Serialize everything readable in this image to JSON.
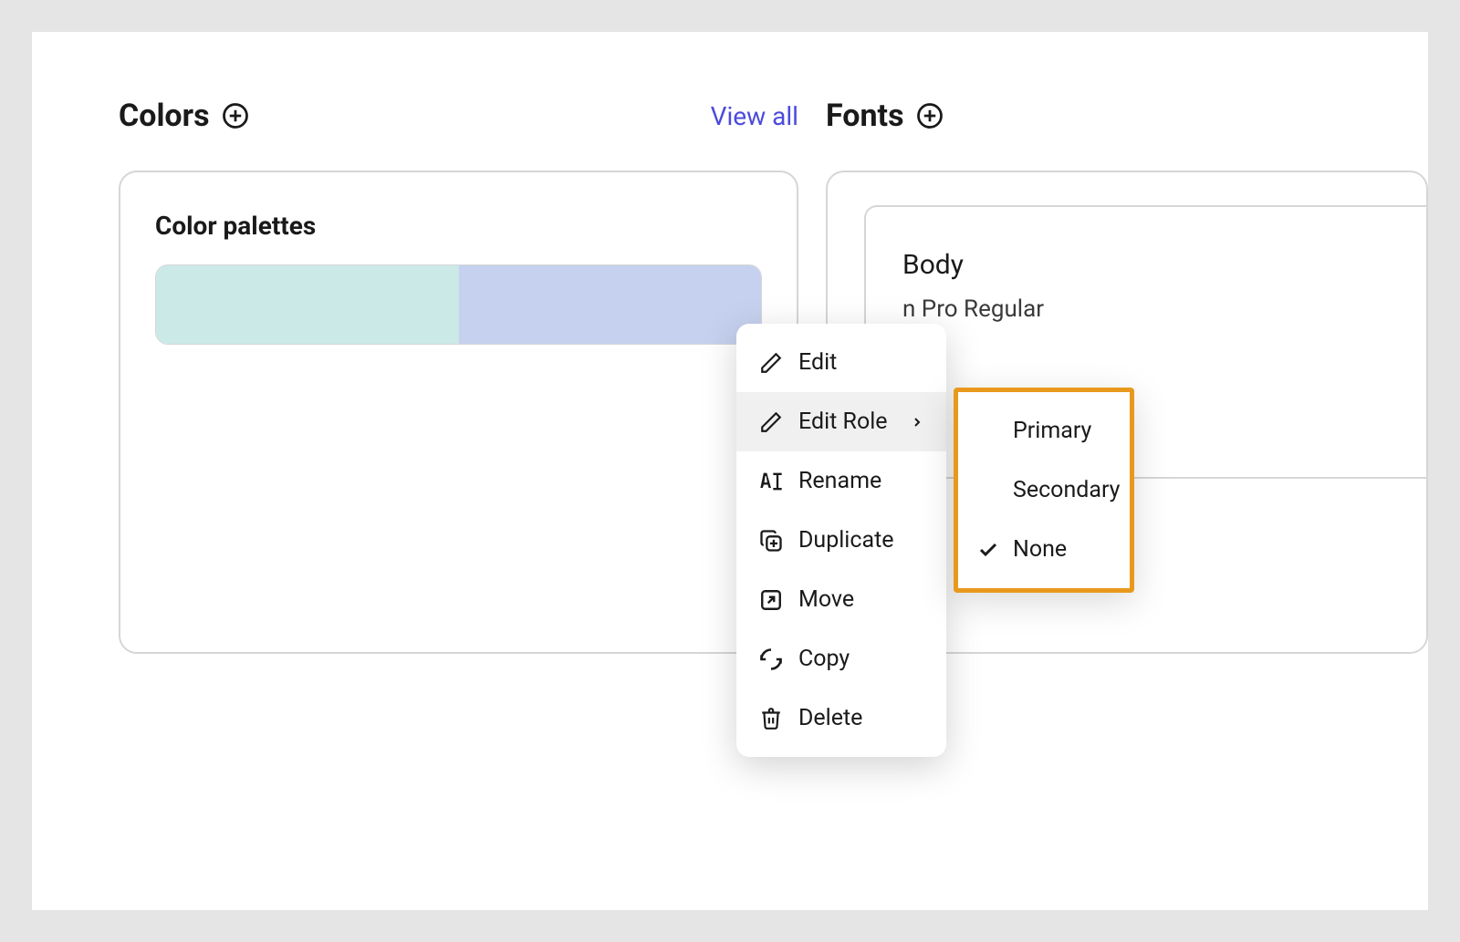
{
  "sections": {
    "colors": {
      "title": "Colors",
      "view_all": "View all",
      "card": {
        "subheading": "Color palettes",
        "palette": [
          {
            "hex": "#cbe9e7"
          },
          {
            "hex": "#c5d1ee"
          }
        ]
      }
    },
    "fonts": {
      "title": "Fonts",
      "card": {
        "label": "Body",
        "font_name_visible": "n Pro Regular"
      }
    }
  },
  "context_menu": {
    "items": [
      {
        "icon": "pencil-icon",
        "label": "Edit"
      },
      {
        "icon": "pencil-icon",
        "label": "Edit Role",
        "has_submenu": true,
        "hovered": true
      },
      {
        "icon": "rename-icon",
        "label": "Rename"
      },
      {
        "icon": "duplicate-icon",
        "label": "Duplicate"
      },
      {
        "icon": "move-icon",
        "label": "Move"
      },
      {
        "icon": "copy-icon",
        "label": "Copy"
      },
      {
        "icon": "delete-icon",
        "label": "Delete"
      }
    ]
  },
  "submenu": {
    "items": [
      {
        "label": "Primary",
        "checked": false
      },
      {
        "label": "Secondary",
        "checked": false
      },
      {
        "label": "None",
        "checked": true
      }
    ]
  },
  "highlight_color": "#e8991c"
}
